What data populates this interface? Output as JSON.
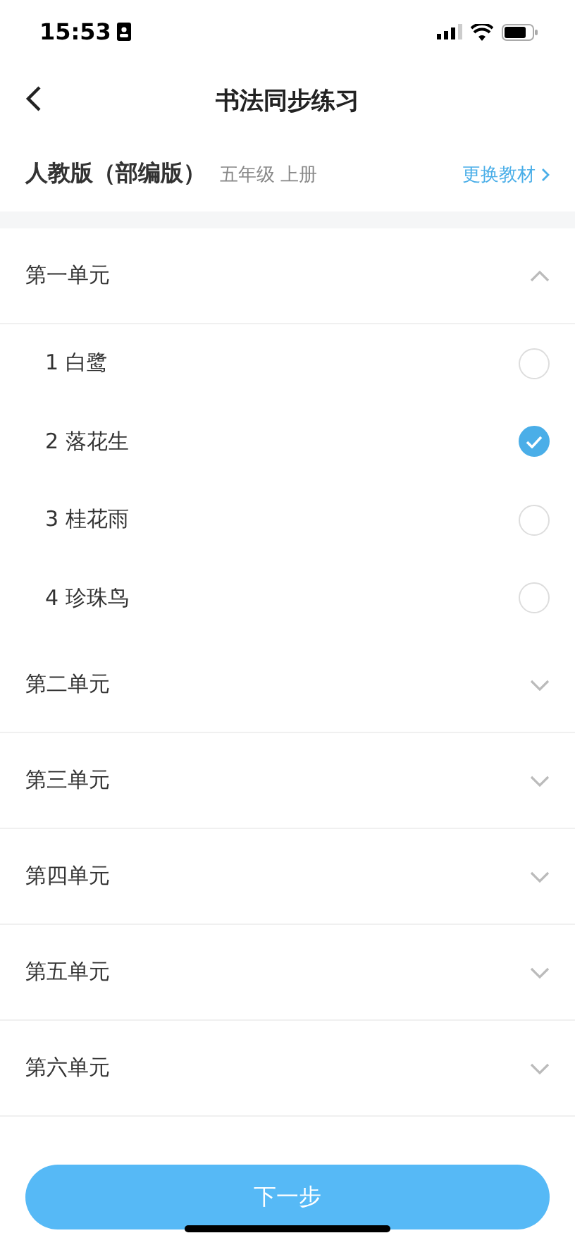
{
  "status_bar": {
    "time": "15:53"
  },
  "nav": {
    "title": "书法同步练习"
  },
  "textbook": {
    "name": "人教版（部编版）",
    "grade": "五年级 上册",
    "change_link": "更换教材"
  },
  "units": [
    {
      "title": "第一单元",
      "expanded": true,
      "lessons": [
        {
          "label": "1 白鹭",
          "selected": false
        },
        {
          "label": "2 落花生",
          "selected": true
        },
        {
          "label": "3 桂花雨",
          "selected": false
        },
        {
          "label": "4 珍珠鸟",
          "selected": false
        }
      ]
    },
    {
      "title": "第二单元",
      "expanded": false
    },
    {
      "title": "第三单元",
      "expanded": false
    },
    {
      "title": "第四单元",
      "expanded": false
    },
    {
      "title": "第五单元",
      "expanded": false
    },
    {
      "title": "第六单元",
      "expanded": false
    }
  ],
  "next_button": "下一步"
}
